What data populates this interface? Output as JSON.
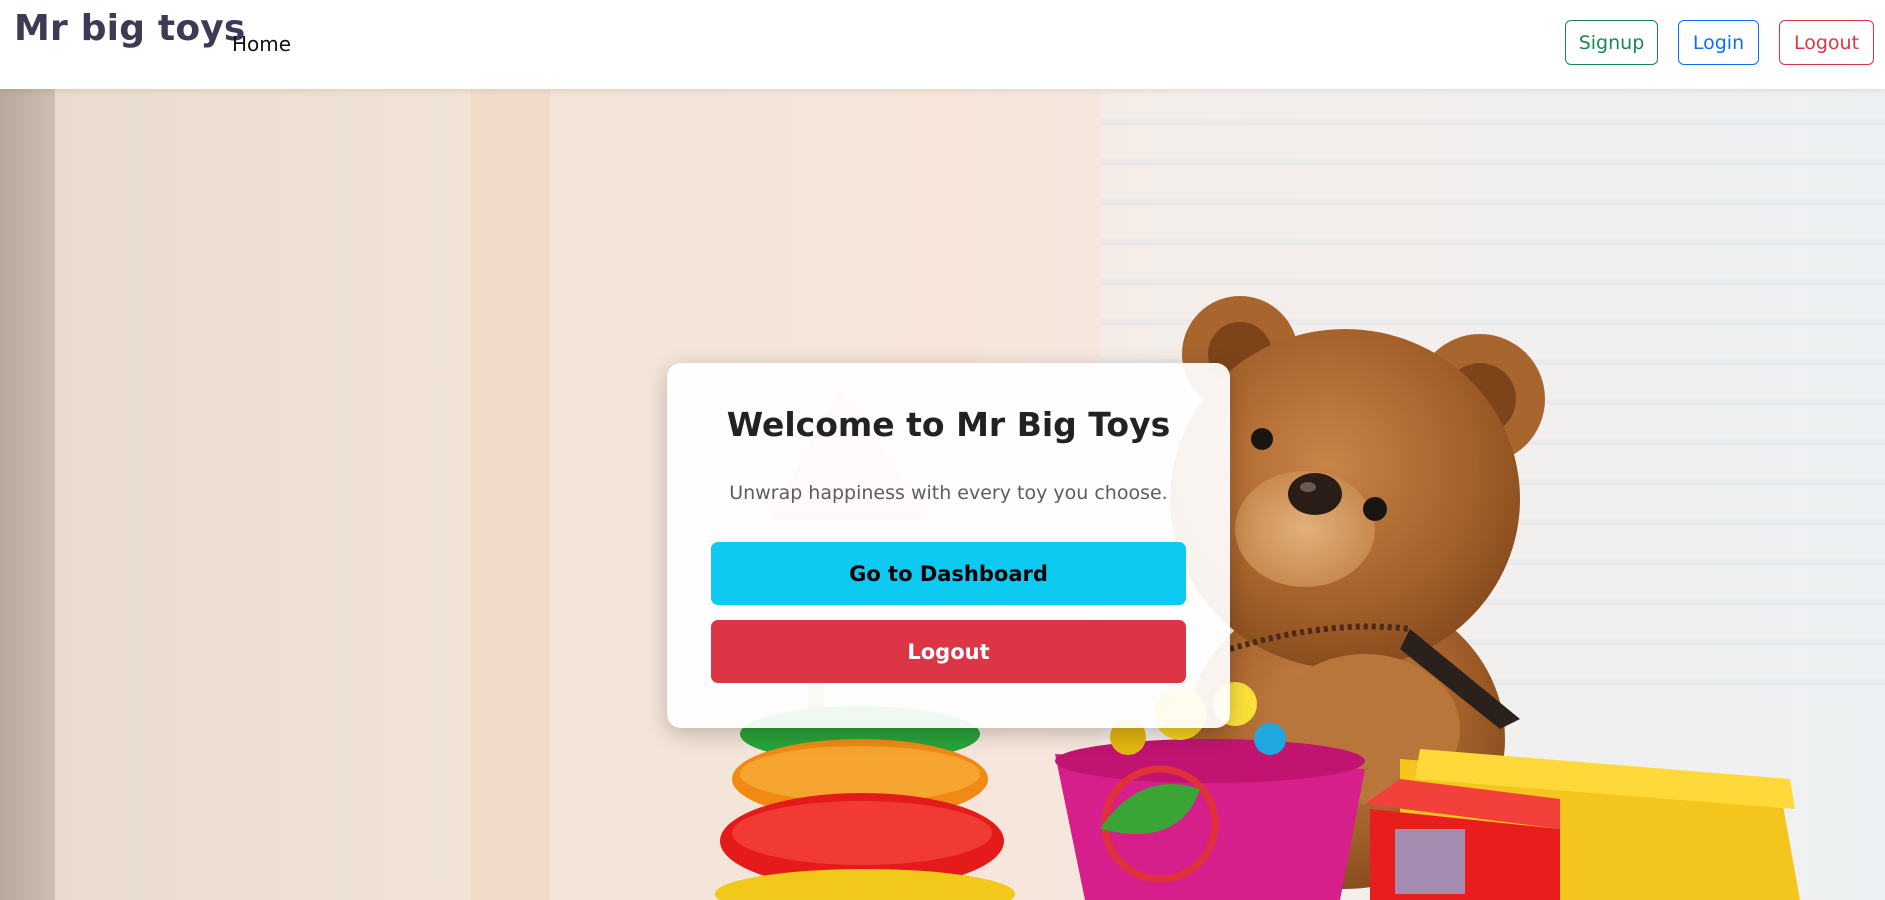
{
  "navbar": {
    "brand": "Mr big toys",
    "home_label": "Home",
    "signup_label": "Signup",
    "login_label": "Login",
    "logout_label": "Logout"
  },
  "hero": {
    "title": "Welcome to Mr Big Toys",
    "subtitle": "Unwrap happiness with every toy you choose.",
    "dashboard_label": "Go to Dashboard",
    "logout_label": "Logout"
  },
  "colors": {
    "brand_text": "#3b3b55",
    "signup": "#198754",
    "login": "#0d6efd",
    "logout": "#dc3545",
    "dashboard": "#0dcaf0"
  },
  "background_image": {
    "subject": "teddy bear with toys",
    "icons": [
      "teddy-bear",
      "stacking-rings",
      "toy-truck",
      "toy-bucket"
    ]
  }
}
